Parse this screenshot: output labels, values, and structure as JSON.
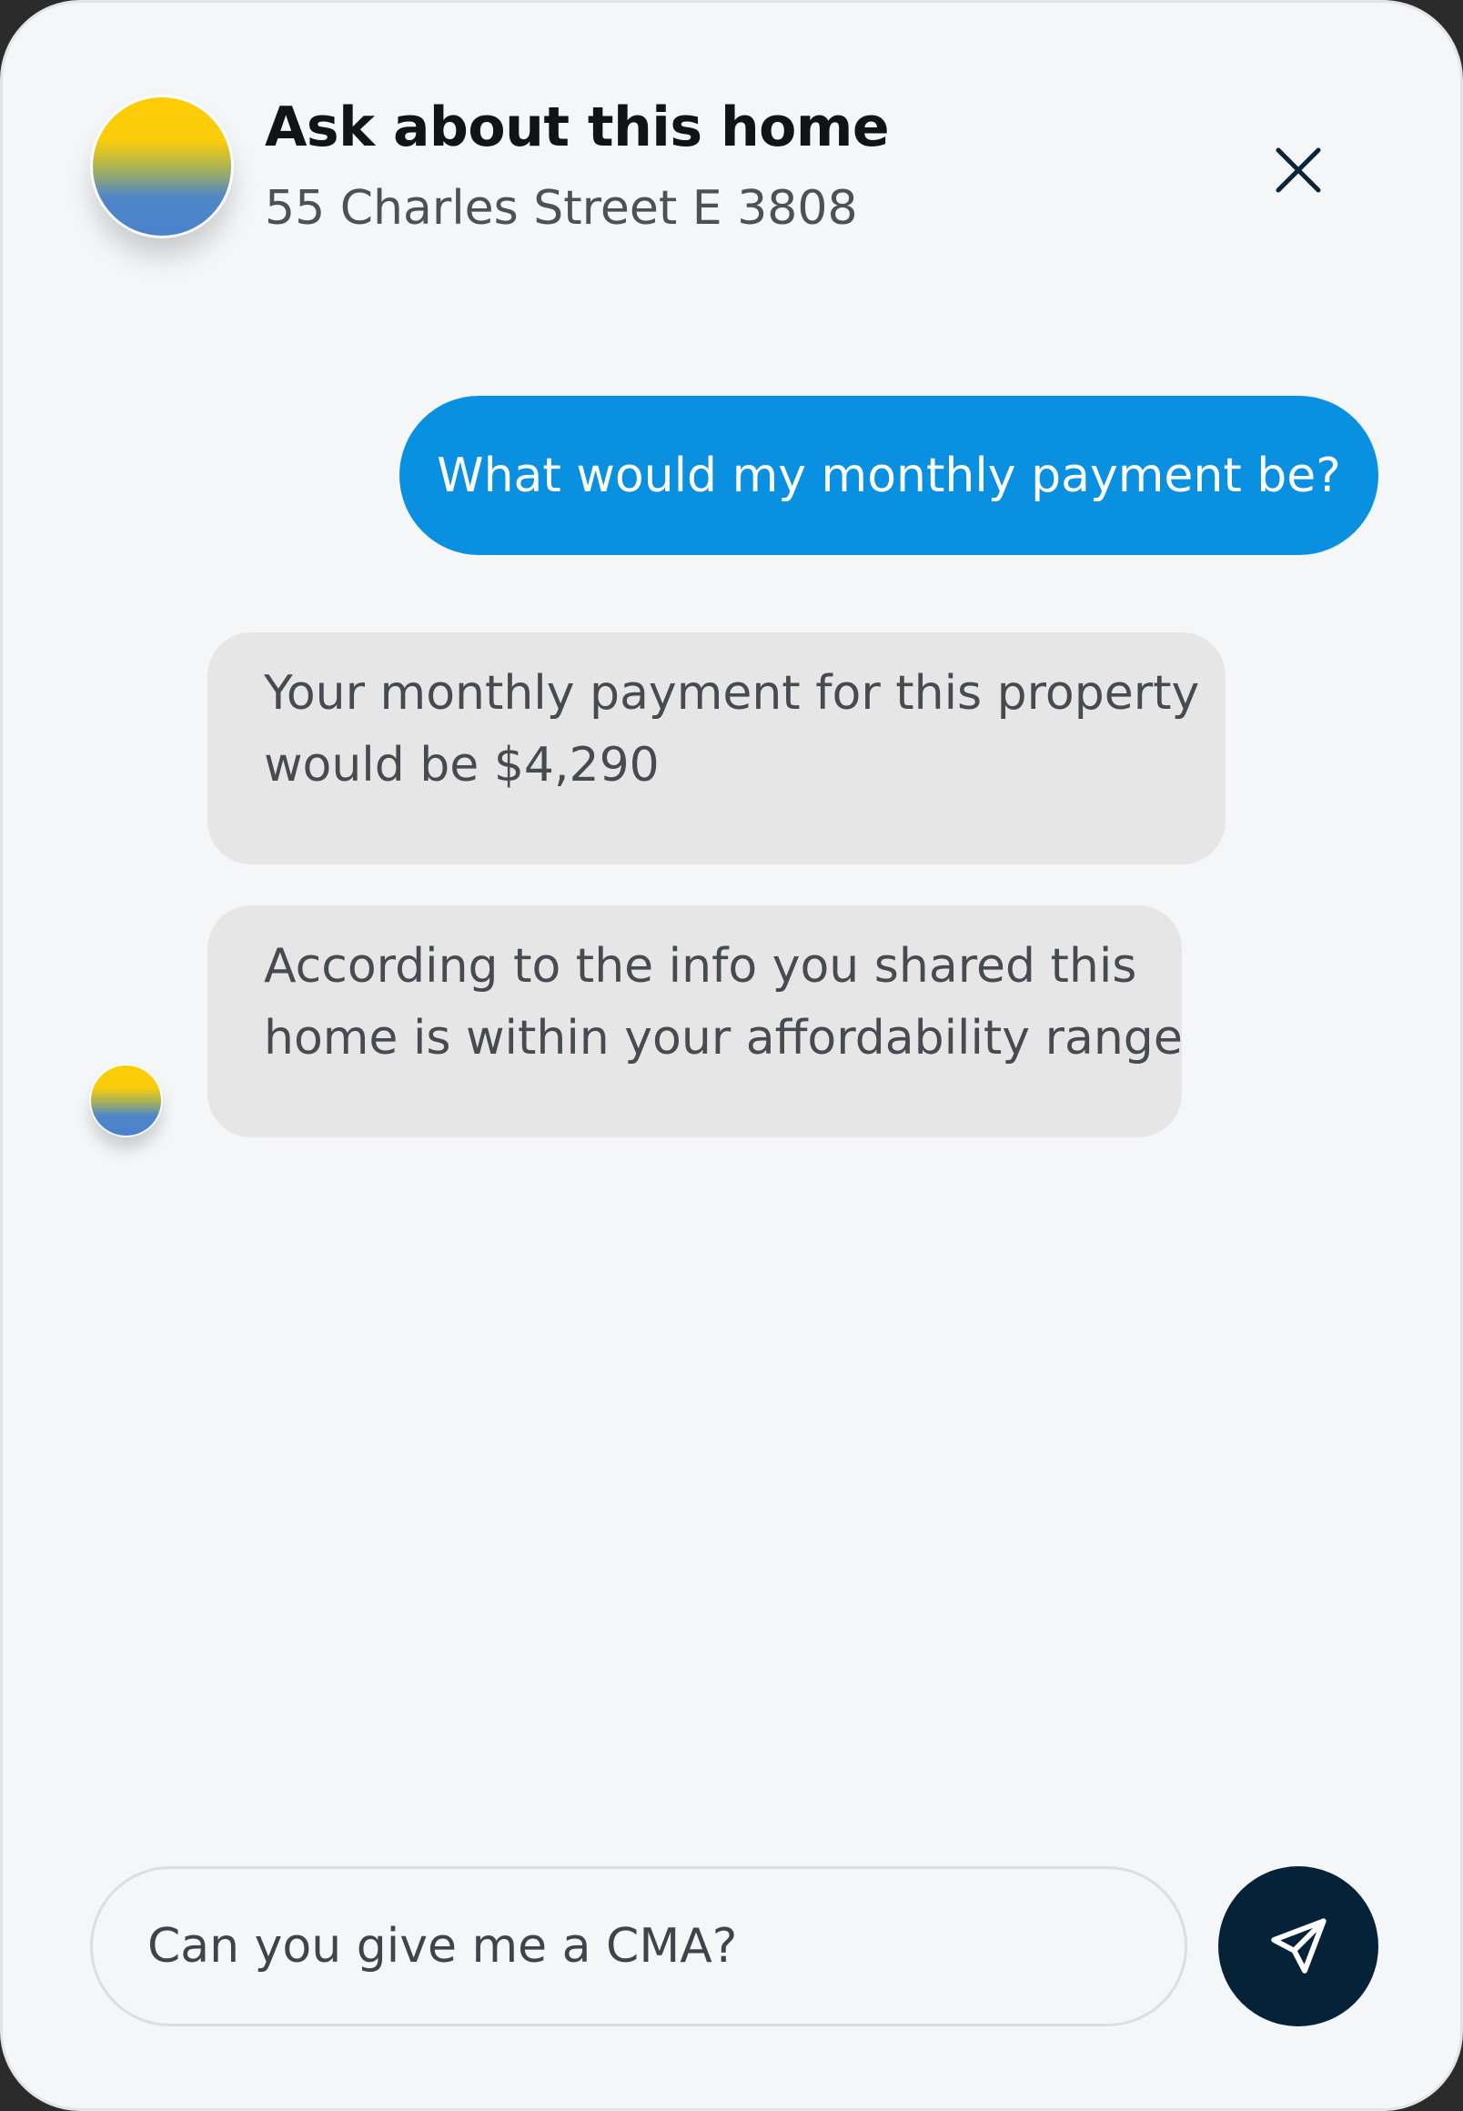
{
  "header": {
    "title": "Ask about this home",
    "address": "55 Charles Street E 3808",
    "close_icon": "close-icon"
  },
  "messages": [
    {
      "role": "user",
      "text": "What would my monthly payment be?"
    },
    {
      "role": "assistant",
      "lines": [
        "Your monthly payment for this property",
        "would be $4,290"
      ]
    },
    {
      "role": "assistant",
      "lines": [
        "According to the info you shared this",
        "home is within your affordability range"
      ]
    }
  ],
  "composer": {
    "value": "Can you give me a CMA?",
    "send_icon": "send-icon"
  },
  "colors": {
    "user_bubble": "#0990e0",
    "assistant_bubble": "#e6e6e7",
    "send_button": "#052238",
    "background": "#f4f6f8",
    "orb_top": "#ffcd05",
    "orb_bottom": "#4a82cc"
  }
}
